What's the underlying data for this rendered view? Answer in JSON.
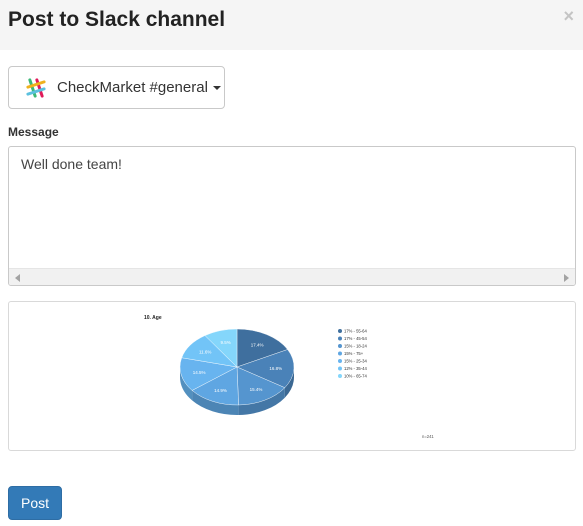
{
  "dialog": {
    "title": "Post to Slack channel",
    "close_glyph": "×",
    "close_icon": "close-icon"
  },
  "channel": {
    "selected": "CheckMarket #general",
    "icon": "slack-logo-icon"
  },
  "message": {
    "label": "Message",
    "value": "Well done team!"
  },
  "chart_data": {
    "type": "pie",
    "title": "10. Age",
    "slices": [
      {
        "label": "17% - 55-64",
        "value": 17.4,
        "color": "#3f6f9e"
      },
      {
        "label": "17% - 45-54",
        "value": 16.8,
        "color": "#4a82b8"
      },
      {
        "label": "15% - 18-24",
        "value": 15.4,
        "color": "#5595cf"
      },
      {
        "label": "15% - 75+",
        "value": 14.9,
        "color": "#5fa6e2"
      },
      {
        "label": "15% - 25-34",
        "value": 14.5,
        "color": "#68b4ef"
      },
      {
        "label": "12% - 35-44",
        "value": 11.6,
        "color": "#72c4f7"
      },
      {
        "label": "10% - 65-74",
        "value": 9.5,
        "color": "#84d6fb"
      }
    ],
    "note": "n=241",
    "legend_position": "right"
  },
  "actions": {
    "post_label": "Post"
  }
}
